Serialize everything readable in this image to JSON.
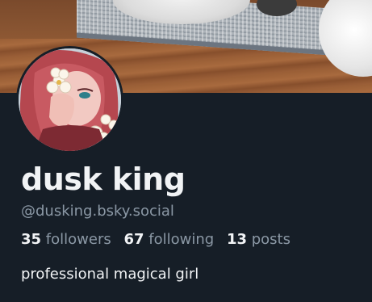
{
  "profile": {
    "display_name": "dusk king",
    "handle": "@dusking.bsky.social",
    "bio": "professional magical girl"
  },
  "stats": {
    "followers_count": "35",
    "followers_label": "followers",
    "following_count": "67",
    "following_label": "following",
    "posts_count": "13",
    "posts_label": "posts"
  },
  "colors": {
    "background": "#161e27",
    "primary_text": "#f1f3f5",
    "secondary_text": "#8b98a5"
  },
  "icons": {
    "banner": "banner-image",
    "avatar": "avatar-image"
  }
}
